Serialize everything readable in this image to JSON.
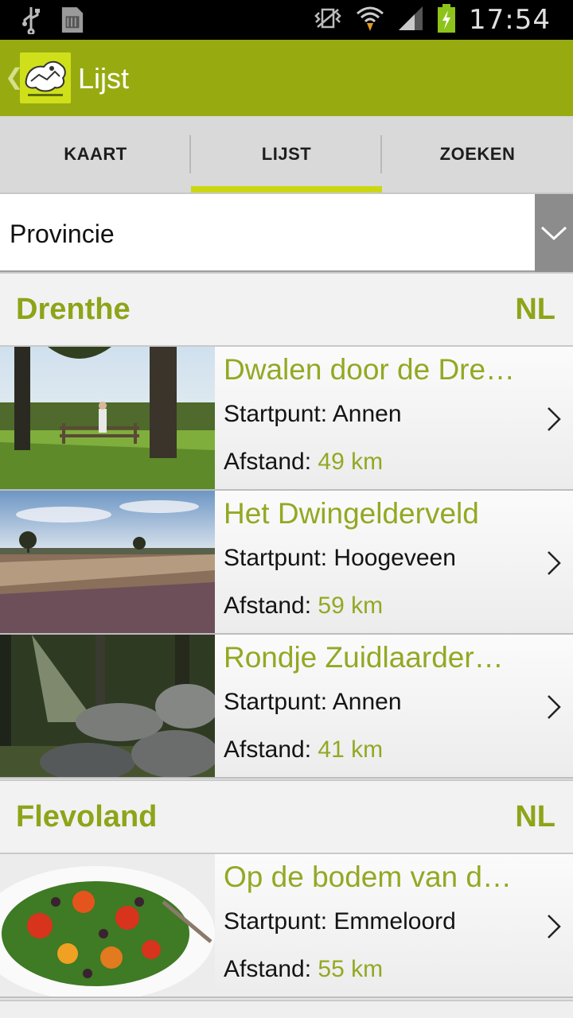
{
  "status_bar": {
    "time": "17:54",
    "icons": [
      "usb-icon",
      "sd-card-icon",
      "vibrate-icon",
      "wifi-icon",
      "signal-icon",
      "battery-charging-icon"
    ]
  },
  "action_bar": {
    "title": "Lijst",
    "icons": [
      "back-chevron-icon",
      "app-logo-icon"
    ]
  },
  "tabs": [
    {
      "label": "KAART",
      "active": false
    },
    {
      "label": "LIJST",
      "active": true
    },
    {
      "label": "ZOEKEN",
      "active": false
    }
  ],
  "filter": {
    "selected": "Provincie",
    "icon": "chevron-down-icon"
  },
  "sections": [
    {
      "name": "Drenthe",
      "country": "NL",
      "routes": [
        {
          "title": "Dwalen door de Dre…",
          "start_label": "Startpunt:",
          "start_value": "Annen",
          "dist_label": "Afstand:",
          "dist_value": "49 km",
          "thumb": "forest-fence-photo"
        },
        {
          "title": "Het Dwingelderveld",
          "start_label": "Startpunt:",
          "start_value": "Hoogeveen",
          "dist_label": "Afstand:",
          "dist_value": "59 km",
          "thumb": "heath-landscape-photo"
        },
        {
          "title": "Rondje Zuidlaarder…",
          "start_label": "Startpunt:",
          "start_value": "Annen",
          "dist_label": "Afstand:",
          "dist_value": "41 km",
          "thumb": "dolmen-forest-photo"
        }
      ]
    },
    {
      "name": "Flevoland",
      "country": "NL",
      "routes": [
        {
          "title": "Op de bodem van d…",
          "start_label": "Startpunt:",
          "start_value": "Emmeloord",
          "dist_label": "Afstand:",
          "dist_value": "55 km",
          "thumb": "salad-photo"
        }
      ]
    }
  ],
  "colors": {
    "accent": "#97ab11",
    "tab_indicator": "#cbd714",
    "text_green": "#94a823"
  }
}
